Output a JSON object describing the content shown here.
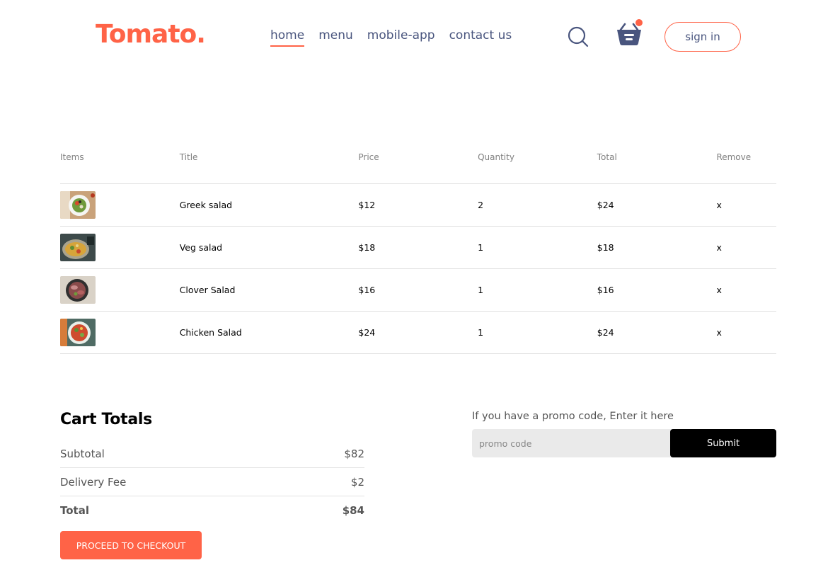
{
  "brand": {
    "logo": "Tomato.",
    "accent": "#ff6347",
    "nav_text": "#49557e"
  },
  "nav": {
    "links": [
      {
        "label": "home",
        "active": true
      },
      {
        "label": "menu",
        "active": false
      },
      {
        "label": "mobile-app",
        "active": false
      },
      {
        "label": "contact us",
        "active": false
      }
    ],
    "search_icon": "search-icon",
    "basket_icon": "basket-icon",
    "signin_label": "sign in"
  },
  "cart": {
    "headers": [
      "Items",
      "Title",
      "Price",
      "Quantity",
      "Total",
      "Remove"
    ],
    "items": [
      {
        "title": "Greek salad",
        "price": "$12",
        "quantity": "2",
        "total": "$24",
        "remove": "x",
        "thumb": "greek-salad-image"
      },
      {
        "title": "Veg salad",
        "price": "$18",
        "quantity": "1",
        "total": "$18",
        "remove": "x",
        "thumb": "veg-salad-image"
      },
      {
        "title": "Clover Salad",
        "price": "$16",
        "quantity": "1",
        "total": "$16",
        "remove": "x",
        "thumb": "clover-salad-image"
      },
      {
        "title": "Chicken Salad",
        "price": "$24",
        "quantity": "1",
        "total": "$24",
        "remove": "x",
        "thumb": "chicken-salad-image"
      }
    ]
  },
  "totals": {
    "title": "Cart Totals",
    "subtotal_label": "Subtotal",
    "subtotal_value": "$82",
    "delivery_label": "Delivery Fee",
    "delivery_value": "$2",
    "total_label": "Total",
    "total_value": "$84",
    "checkout_label": "PROCEED TO CHECKOUT"
  },
  "promo": {
    "prompt": "If you have a promo code, Enter it here",
    "placeholder": "promo code",
    "submit_label": "Submit"
  }
}
